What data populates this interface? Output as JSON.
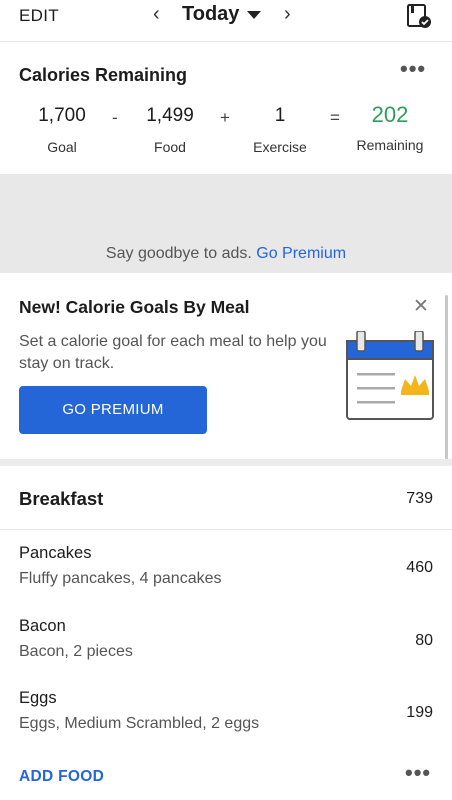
{
  "topbar": {
    "edit_label": "EDIT",
    "prev_icon": "‹",
    "date_label": "Today",
    "next_icon": "›",
    "diary_icon": "diary-check-icon"
  },
  "calories": {
    "title": "Calories Remaining",
    "more": "•••",
    "goal": {
      "value": "1,700",
      "label": "Goal"
    },
    "op1": "-",
    "food": {
      "value": "1,499",
      "label": "Food"
    },
    "op2": "+",
    "exercise": {
      "value": "1",
      "label": "Exercise"
    },
    "op3": "=",
    "remaining": {
      "value": "202",
      "label": "Remaining"
    },
    "remaining_color": "#2e9e5b"
  },
  "ad": {
    "text": "Say goodbye to ads.",
    "link": "Go Premium"
  },
  "promo": {
    "title": "New! Calorie Goals By Meal",
    "close": "✕",
    "description": "Set a calorie goal for each meal to help you stay on track.",
    "button": "GO PREMIUM",
    "button_color": "#2466d8"
  },
  "diary": {
    "meal": "Breakfast",
    "meal_total": "739",
    "foods": [
      {
        "name": "Pancakes",
        "desc": "Fluffy pancakes, 4 pancakes",
        "cal": "460"
      },
      {
        "name": "Bacon",
        "desc": "Bacon, 2 pieces",
        "cal": "80"
      },
      {
        "name": "Eggs",
        "desc": "Eggs, Medium Scrambled, 2 eggs",
        "cal": "199"
      }
    ],
    "add_food": "ADD FOOD",
    "more": "•••"
  }
}
